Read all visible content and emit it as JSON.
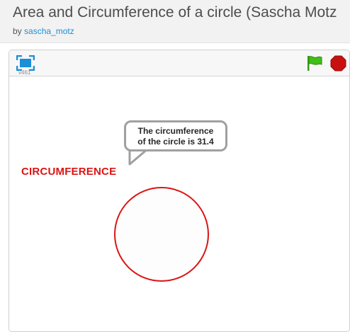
{
  "header": {
    "title": "Area and Circumference of a circle (Sascha Motz",
    "by_prefix": "by",
    "author": "sascha_motz"
  },
  "player": {
    "version": "v461",
    "fullscreen_icon": "fullscreen-icon",
    "green_flag_icon": "green-flag-icon",
    "stop_icon": "stop-sign-icon"
  },
  "stage": {
    "label": "CIRCUMFERENCE",
    "speech_line1": "The circumference",
    "speech_line2": "of the circle is 31.4",
    "colors": {
      "label": "#dc1414",
      "circle_stroke": "#dc1414",
      "circle_fill": "#fdfdfd",
      "flag_green": "#3fbf17",
      "stop_red": "#c81010",
      "link_blue": "#1d8fd6"
    }
  }
}
